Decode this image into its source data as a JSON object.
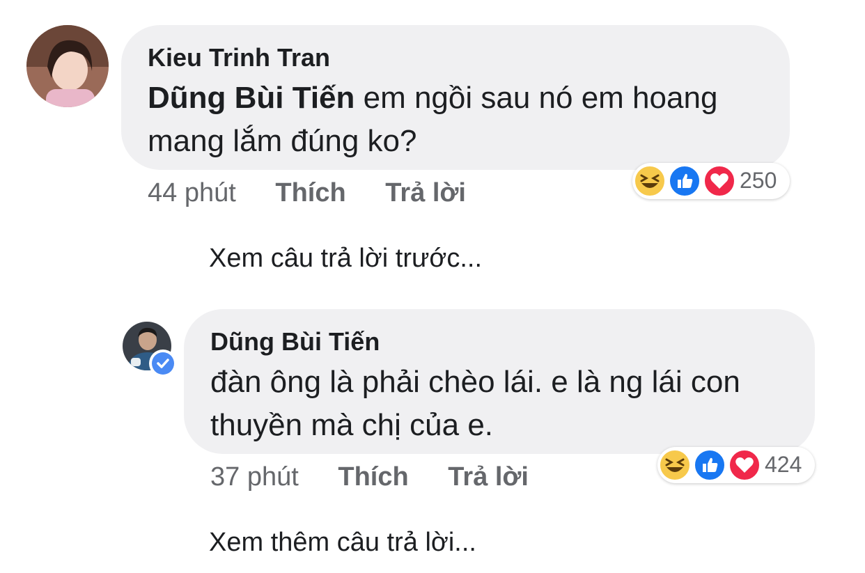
{
  "comment1": {
    "author": "Kieu Trinh Tran",
    "mention": "Dũng Bùi Tiến",
    "text": " em ngồi sau nó em hoang mang lắm đúng ko?",
    "time": "44 phút",
    "like_label": "Thích",
    "reply_label": "Trả lời",
    "reaction_count": "250",
    "reactions": [
      "haha-icon",
      "like-icon",
      "love-icon"
    ]
  },
  "view_previous_replies": "Xem câu trả lời trước...",
  "reply1": {
    "author": "Dũng Bùi Tiến",
    "text": "đàn ông là phải chèo lái. e là ng lái con thuyền mà chị của e.",
    "time": "37 phút",
    "like_label": "Thích",
    "reply_label": "Trả lời",
    "reaction_count": "424",
    "reactions": [
      "haha-icon",
      "like-icon",
      "love-icon"
    ]
  },
  "view_more_replies": "Xem thêm câu trả lời...",
  "colors": {
    "bubble": "#f0f0f2",
    "like": "#1877f2",
    "love": "#f0284a",
    "haha": "#f7c94b",
    "verified": "#4a8af4"
  }
}
